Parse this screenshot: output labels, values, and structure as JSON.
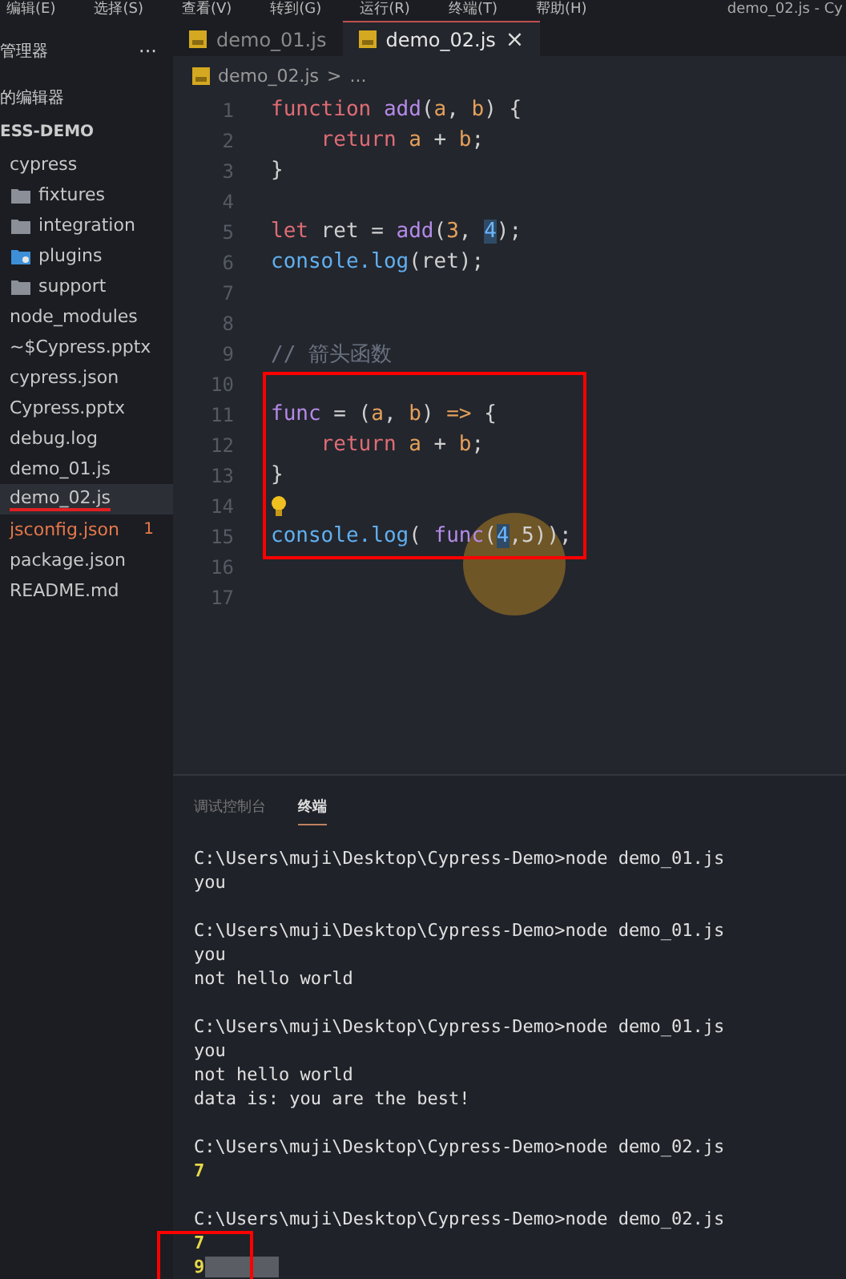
{
  "menu": [
    "编辑(E)",
    "选择(S)",
    "查看(V)",
    "转到(G)",
    "运行(R)",
    "终端(T)",
    "帮助(H)"
  ],
  "window": {
    "title": "demo_02.js - Cy"
  },
  "sidebar": {
    "title": "管理器",
    "more": "···",
    "open_editors": "的编辑器",
    "project": "ESS-DEMO",
    "items": [
      {
        "label": "cypress",
        "selected": false,
        "children": [
          {
            "label": "fixtures",
            "kind": "folder",
            "selected": false
          },
          {
            "label": "integration",
            "kind": "folder",
            "selected": false
          },
          {
            "label": "plugins",
            "kind": "plugin-folder",
            "selected": false
          },
          {
            "label": "support",
            "kind": "folder",
            "selected": false
          }
        ]
      },
      {
        "label": "node_modules",
        "selected": false
      },
      {
        "label": "~$Cypress.pptx",
        "selected": false
      },
      {
        "label": "cypress.json",
        "selected": false
      },
      {
        "label": "Cypress.pptx",
        "selected": false
      },
      {
        "label": "debug.log",
        "selected": false
      },
      {
        "label": "demo_01.js",
        "selected": false
      },
      {
        "label": "demo_02.js",
        "selected": true,
        "underlined": true
      },
      {
        "label": "jsconfig.json",
        "selected": false,
        "error": true,
        "count": "1"
      },
      {
        "label": "package.json",
        "selected": false
      },
      {
        "label": "README.md",
        "selected": false
      }
    ]
  },
  "tabs": [
    {
      "label": "demo_01.js",
      "selected": false
    },
    {
      "label": "demo_02.js",
      "selected": true,
      "close": "×"
    }
  ],
  "breadcrumb": {
    "file": "demo_02.js",
    "separator": ">",
    "rest": "..."
  },
  "code": [
    {
      "n": "1",
      "tokens": [
        {
          "keyword": "function"
        },
        {
          "function": " add"
        },
        {
          "plain": "("
        },
        {
          "param": "a"
        },
        {
          "plain": ", "
        },
        {
          "param": "b"
        },
        {
          "plain": ") {"
        }
      ]
    },
    {
      "n": "2",
      "tokens": [
        {
          "keyword": "    return"
        },
        {
          "param": " a"
        },
        {
          "plain": " + "
        },
        {
          "param": "b"
        },
        {
          "plain": ";"
        }
      ]
    },
    {
      "n": "3",
      "tokens": [
        {
          "plain": "}"
        }
      ]
    },
    {
      "n": "4"
    },
    {
      "n": "5",
      "tokens": [
        {
          "keyword": "let"
        },
        {
          "plain": " ret = "
        },
        {
          "function": "add"
        },
        {
          "plain": "("
        },
        {
          "number": "3"
        },
        {
          "plain": ", "
        },
        {
          "highlighted": "4"
        },
        {
          "plain": ");"
        }
      ]
    },
    {
      "n": "6",
      "tokens": [
        {
          "object": "console.log"
        },
        {
          "plain": "(ret);"
        }
      ]
    },
    {
      "n": "7"
    },
    {
      "n": "8"
    },
    {
      "n": "9",
      "tokens": [
        {
          "comment": "// 箭头函数"
        }
      ]
    },
    {
      "n": "10"
    },
    {
      "n": "11",
      "tokens": [
        {
          "function": "func"
        },
        {
          "plain": " = ("
        },
        {
          "param": "a"
        },
        {
          "plain": ", "
        },
        {
          "param": "b"
        },
        {
          "plain": ") "
        },
        {
          "param": "=>"
        },
        {
          "plain": " {"
        }
      ]
    },
    {
      "n": "12",
      "tokens": [
        {
          "keyword": "    return"
        },
        {
          "param": " a"
        },
        {
          "plain": " + "
        },
        {
          "param": "b"
        },
        {
          "plain": ";"
        }
      ]
    },
    {
      "n": "13",
      "tokens": [
        {
          "plain": "}"
        }
      ]
    },
    {
      "n": "14",
      "lightbulb": true
    },
    {
      "n": "15",
      "tokens": [
        {
          "object": "console.log"
        },
        {
          "plain": "( "
        },
        {
          "function": "func"
        },
        {
          "plain": "("
        },
        {
          "highlighted": "4"
        },
        {
          "plain": ",5));"
        }
      ]
    },
    {
      "n": "16"
    },
    {
      "n": "17"
    }
  ],
  "panel": {
    "tabs": [
      {
        "label": "调试控制台",
        "selected": false
      },
      {
        "label": "终端",
        "selected": true
      }
    ],
    "lines": [
      {
        "kind": "command",
        "text": "C:\\Users\\muji\\Desktop\\Cypress-Demo>node demo_01.js"
      },
      {
        "kind": "output",
        "text": "you"
      },
      {
        "kind": "blank"
      },
      {
        "kind": "command",
        "text": "C:\\Users\\muji\\Desktop\\Cypress-Demo>node demo_01.js"
      },
      {
        "kind": "output",
        "text": "you"
      },
      {
        "kind": "output",
        "text": "not hello world"
      },
      {
        "kind": "blank"
      },
      {
        "kind": "command",
        "text": "C:\\Users\\muji\\Desktop\\Cypress-Demo>node demo_01.js"
      },
      {
        "kind": "output",
        "text": "you"
      },
      {
        "kind": "output",
        "text": "not hello world"
      },
      {
        "kind": "output",
        "text": "data is: you are the best!"
      },
      {
        "kind": "blank"
      },
      {
        "kind": "command",
        "text": "C:\\Users\\muji\\Desktop\\Cypress-Demo>node demo_02.js"
      },
      {
        "kind": "result",
        "text": "7"
      },
      {
        "kind": "blank"
      },
      {
        "kind": "command",
        "text": "C:\\Users\\muji\\Desktop\\Cypress-Demo>node demo_02.js"
      },
      {
        "kind": "result",
        "text": "7"
      },
      {
        "kind": "result",
        "text": "9",
        "cursor": true
      }
    ]
  }
}
